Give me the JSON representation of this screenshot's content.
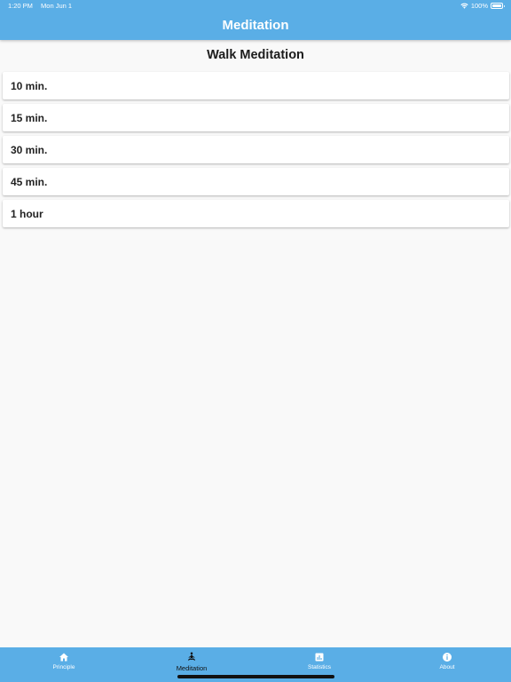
{
  "status_bar": {
    "time": "1:20 PM",
    "date": "Mon Jun 1",
    "battery": "100%",
    "wifi_icon": "wifi-icon",
    "battery_icon": "battery-icon"
  },
  "header": {
    "title": "Meditation"
  },
  "main": {
    "title": "Walk Meditation",
    "items": [
      {
        "label": "10 min."
      },
      {
        "label": "15 min."
      },
      {
        "label": "30 min."
      },
      {
        "label": "45 min."
      },
      {
        "label": "1 hour"
      }
    ]
  },
  "tabbar": {
    "tabs": [
      {
        "label": "Principle",
        "icon": "home-icon"
      },
      {
        "label": "Meditation",
        "icon": "meditation-figure-icon",
        "active": true
      },
      {
        "label": "Statistics",
        "icon": "bar-chart-icon"
      },
      {
        "label": "About",
        "icon": "info-icon"
      }
    ]
  },
  "colors": {
    "primary": "#5aaee6",
    "background": "#f9f9f9",
    "card": "#ffffff",
    "text": "#222222"
  }
}
